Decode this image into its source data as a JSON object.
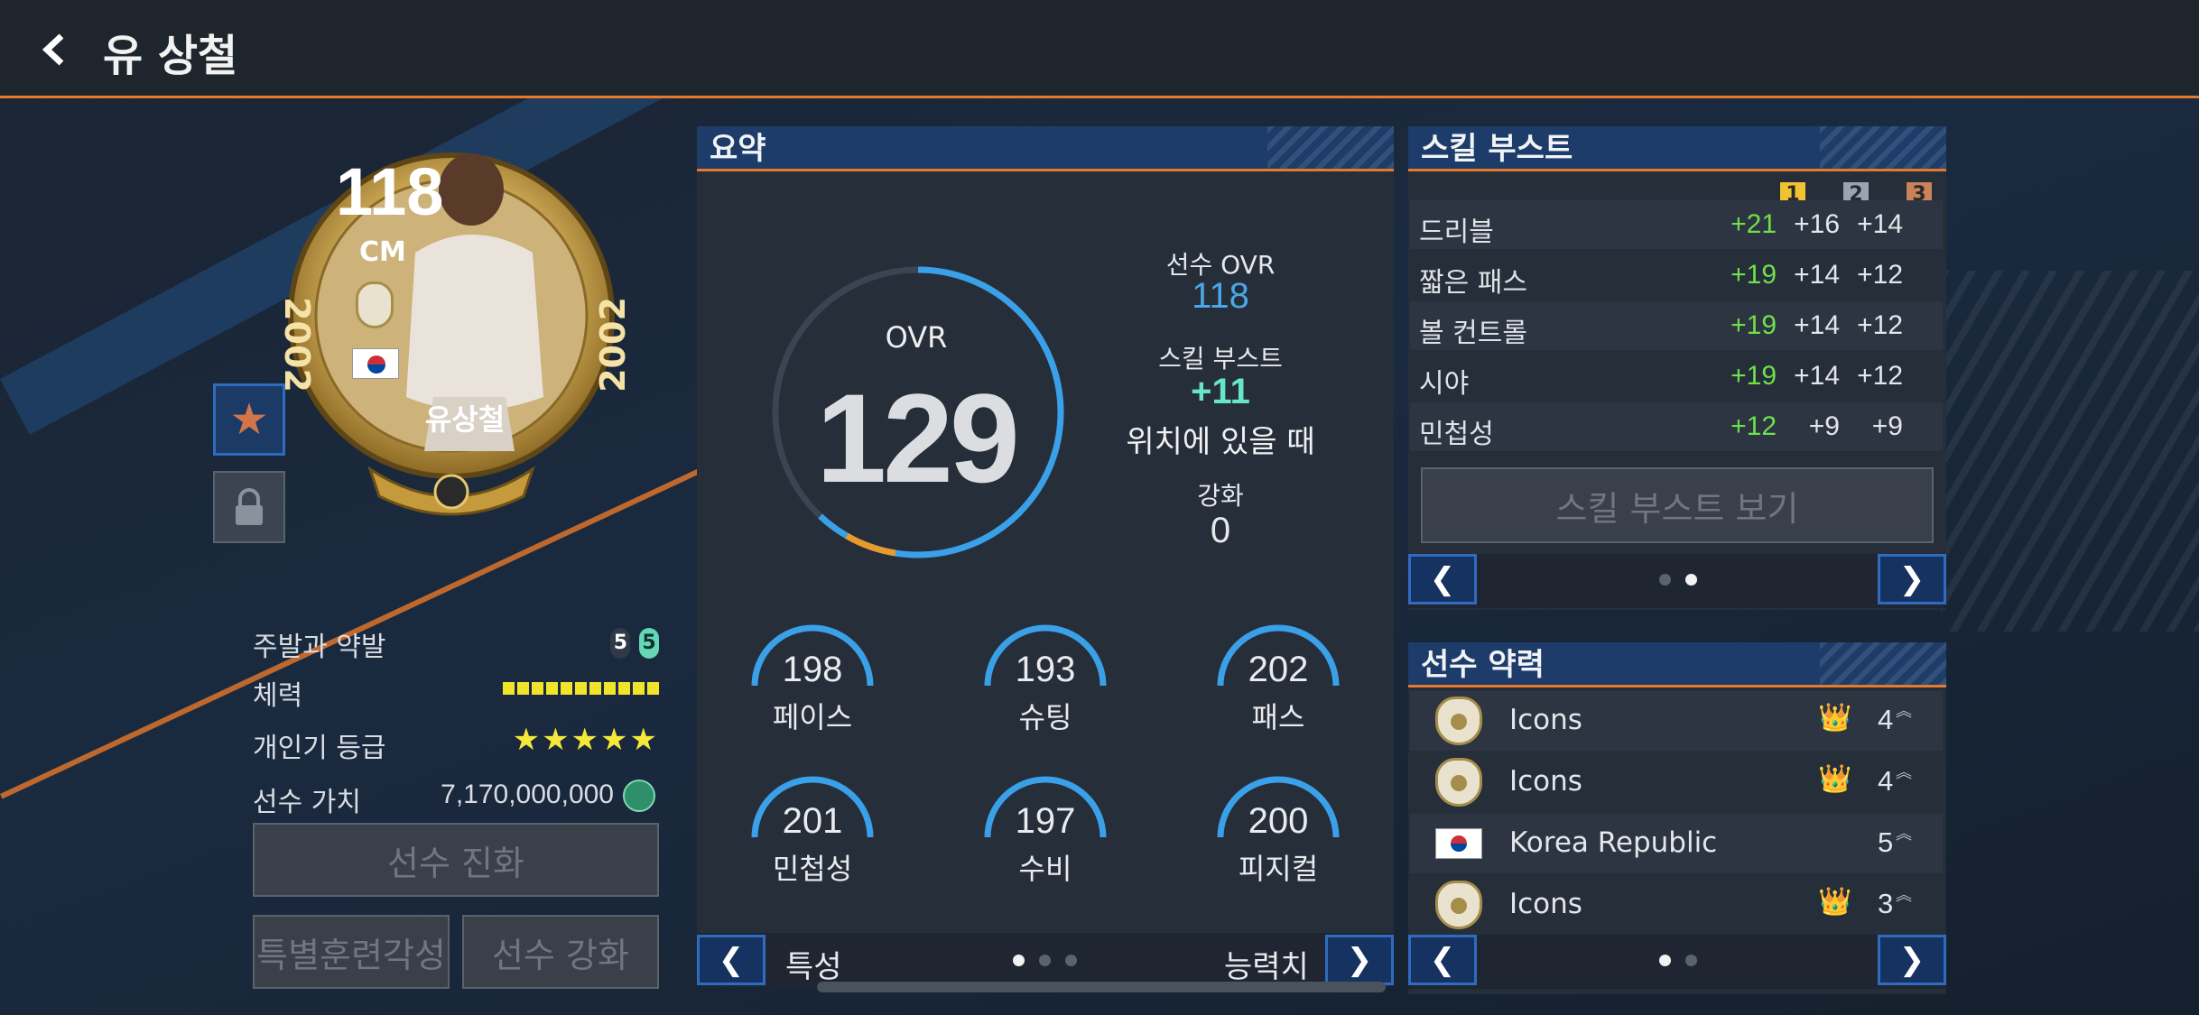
{
  "header": {
    "back_icon": "chevron-left-icon",
    "title": "유 상철"
  },
  "player_card": {
    "ovr": "118",
    "position": "CM",
    "year_left": "2002",
    "year_right": "2002",
    "name": "유상철",
    "flag": "korea-flag-icon"
  },
  "side_buttons": {
    "favorite_icon": "star-icon",
    "lock_icon": "lock-icon"
  },
  "player_info": {
    "foot_label": "주발과 약발",
    "foot_main": "5",
    "foot_weak": "5",
    "stamina_label": "체력",
    "stamina_segments": 11,
    "reputation_label": "개인기 등급",
    "reputation_stars": "★★★★★",
    "value_label": "선수 가치",
    "value": "7,170,000,000"
  },
  "buttons": {
    "evolve": "선수 진화",
    "special_training": "특별훈련각성",
    "enhance": "선수 강화"
  },
  "summary": {
    "title": "요약",
    "ovr_label": "OVR",
    "ovr_value": "129",
    "ovr_progress": 0.62,
    "player_ovr_label": "선수 OVR",
    "player_ovr_value": "118",
    "skill_boost_label": "스킬 부스트",
    "skill_boost_value": "+11",
    "skill_boost_note": "위치에 있을 때",
    "upgrade_label": "강화",
    "upgrade_value": "0",
    "stats": [
      {
        "value": "198",
        "name": "페이스"
      },
      {
        "value": "193",
        "name": "슈팅"
      },
      {
        "value": "202",
        "name": "패스"
      },
      {
        "value": "201",
        "name": "민첩성"
      },
      {
        "value": "197",
        "name": "수비"
      },
      {
        "value": "200",
        "name": "피지컬"
      }
    ],
    "nav_left_label": "특성",
    "nav_right_label": "능력치",
    "arrow_left": "❮",
    "arrow_right": "❯"
  },
  "skill_boost": {
    "title": "스킬 부스트",
    "tiers": [
      "1",
      "2",
      "3"
    ],
    "tier_colors": [
      "#f1c232",
      "#9aa3b3",
      "#c9825a"
    ],
    "rows": [
      {
        "name": "드리블",
        "v1": "+21",
        "v2": "+16",
        "v3": "+14"
      },
      {
        "name": "짧은 패스",
        "v1": "+19",
        "v2": "+14",
        "v3": "+12"
      },
      {
        "name": "볼 컨트롤",
        "v1": "+19",
        "v2": "+14",
        "v3": "+12"
      },
      {
        "name": "시야",
        "v1": "+19",
        "v2": "+14",
        "v3": "+12"
      },
      {
        "name": "민첩성",
        "v1": "+12",
        "v2": "+9",
        "v3": "+9"
      }
    ],
    "view_button": "스킬 부스트 보기",
    "arrow_left": "❮",
    "arrow_right": "❯"
  },
  "chemistry": {
    "title": "선수 약력",
    "rows": [
      {
        "icon": "icons-badge-icon",
        "name": "Icons",
        "hand": "👑",
        "level": "4"
      },
      {
        "icon": "icons-badge-icon",
        "name": "Icons",
        "hand": "👑",
        "level": "4"
      },
      {
        "icon": "korea-flag-icon",
        "name": "Korea Republic",
        "hand": "",
        "level": "5"
      },
      {
        "icon": "icons-badge-icon",
        "name": "Icons",
        "hand": "👑",
        "level": "3"
      }
    ],
    "arrow_left": "❮",
    "arrow_right": "❯"
  }
}
